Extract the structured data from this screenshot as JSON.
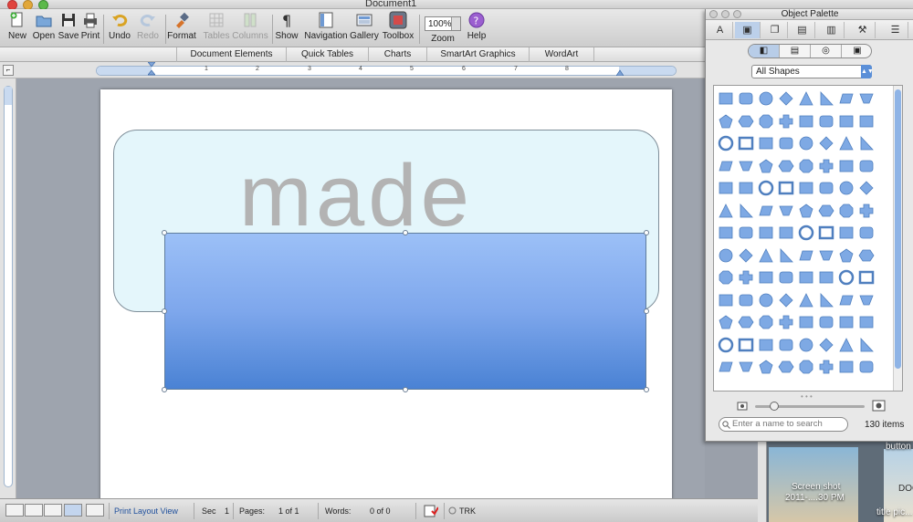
{
  "window": {
    "title": "Document1"
  },
  "toolbar": {
    "items": [
      {
        "label": "New",
        "icon": "new-document-icon"
      },
      {
        "label": "Open",
        "icon": "open-folder-icon"
      },
      {
        "label": "Save",
        "icon": "save-disk-icon"
      },
      {
        "label": "Print",
        "icon": "printer-icon"
      },
      {
        "label": "Undo",
        "icon": "undo-icon"
      },
      {
        "label": "Redo",
        "icon": "redo-icon"
      },
      {
        "label": "Format",
        "icon": "format-brush-icon"
      },
      {
        "label": "Tables",
        "icon": "table-icon"
      },
      {
        "label": "Columns",
        "icon": "columns-icon"
      },
      {
        "label": "Show",
        "icon": "pilcrow-icon"
      },
      {
        "label": "Navigation",
        "icon": "navigation-pane-icon"
      },
      {
        "label": "Gallery",
        "icon": "gallery-icon"
      },
      {
        "label": "Toolbox",
        "icon": "toolbox-icon"
      },
      {
        "label": "Zoom",
        "icon": "zoom-icon"
      },
      {
        "label": "Help",
        "icon": "help-icon"
      }
    ],
    "zoom_value": "100%"
  },
  "ribbon": {
    "tabs": [
      "Document Elements",
      "Quick Tables",
      "Charts",
      "SmartArt Graphics",
      "WordArt"
    ]
  },
  "ruler": {
    "numbers": [
      "1",
      "2",
      "3",
      "4",
      "5",
      "6",
      "7",
      "8"
    ]
  },
  "document": {
    "shape_text": "made",
    "colors": {
      "rounded_fill": "#e4f6fb",
      "rect_top": "#9cc0f7",
      "rect_bottom": "#4a82d4",
      "text": "#b3b3b3"
    }
  },
  "statusbar": {
    "view": "Print Layout View",
    "sec_label": "Sec",
    "sec_value": "1",
    "pages_label": "Pages:",
    "pages_value": "1 of 1",
    "words_label": "Words:",
    "words_value": "0 of 0",
    "trk": "TRK"
  },
  "palette": {
    "title": "Object Palette",
    "category": "All Shapes",
    "search_placeholder": "Enter a name to search",
    "item_count": "130 items"
  },
  "desktop": {
    "file1_line1": "Screen shot",
    "file1_line2": "2011-....30 PM",
    "file2_top": "button",
    "file2_mid": "DOC",
    "file2_bottom": "title pic..."
  }
}
